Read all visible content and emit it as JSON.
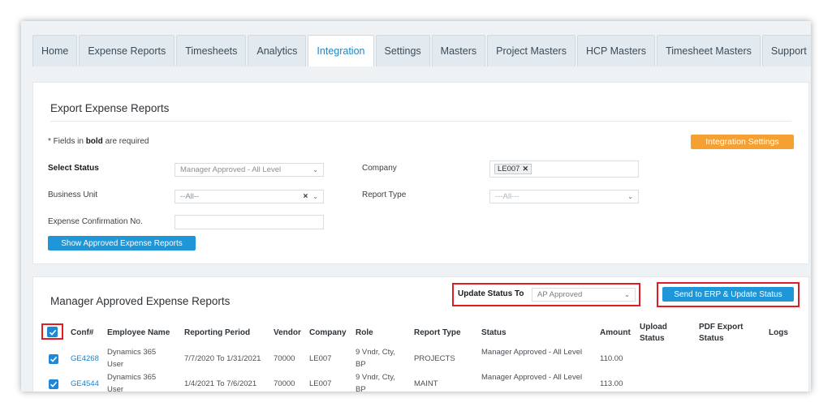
{
  "tabs": [
    "Home",
    "Expense Reports",
    "Timesheets",
    "Analytics",
    "Integration",
    "Settings",
    "Masters",
    "Project Masters",
    "HCP Masters",
    "Timesheet Masters",
    "Support"
  ],
  "active_tab": "Integration",
  "export": {
    "title": "Export Expense Reports",
    "required_note_prefix": "* Fields in ",
    "required_note_bold": "bold",
    "required_note_suffix": " are required",
    "integration_settings_label": "Integration Settings",
    "select_status_label": "Select Status",
    "select_status_value": "Manager Approved - All Level",
    "company_label": "Company",
    "company_chip": "LE007",
    "business_unit_label": "Business Unit",
    "business_unit_value": "--All--",
    "report_type_label": "Report Type",
    "report_type_value": "---All---",
    "confirmation_label": "Expense Confirmation No.",
    "confirmation_value": "",
    "show_button_label": "Show Approved Expense Reports"
  },
  "reports": {
    "title": "Manager Approved Expense Reports",
    "update_status_label": "Update Status To",
    "update_status_value": "AP Approved",
    "send_button_label": "Send to ERP & Update Status",
    "headers": {
      "conf": "Conf#",
      "employee": "Employee Name",
      "period": "Reporting Period",
      "vendor": "Vendor",
      "company": "Company",
      "role": "Role",
      "report_type": "Report Type",
      "status": "Status",
      "amount": "Amount",
      "upload_status": "Upload Status",
      "pdf_export_status": "PDF Export Status",
      "logs": "Logs"
    },
    "rows": [
      {
        "conf": "GE4268",
        "employee": "Dynamics 365 User",
        "period": "7/7/2020 To 1/31/2021",
        "vendor": "70000",
        "company": "LE007",
        "role": "9 Vndr, Cty, BP",
        "report_type": "PROJECTS",
        "status": "Manager Approved - All Level",
        "amount": "110.00"
      },
      {
        "conf": "GE4544",
        "employee": "Dynamics 365 User",
        "period": "1/4/2021 To 7/6/2021",
        "vendor": "70000",
        "company": "LE007",
        "role": "9 Vndr, Cty, BP",
        "report_type": "MAINT",
        "status": "Manager Approved - All Level",
        "amount": "113.00"
      }
    ]
  },
  "colors": {
    "accent": "#1e96d7",
    "orange": "#f5a033",
    "highlight": "#e01d25"
  }
}
